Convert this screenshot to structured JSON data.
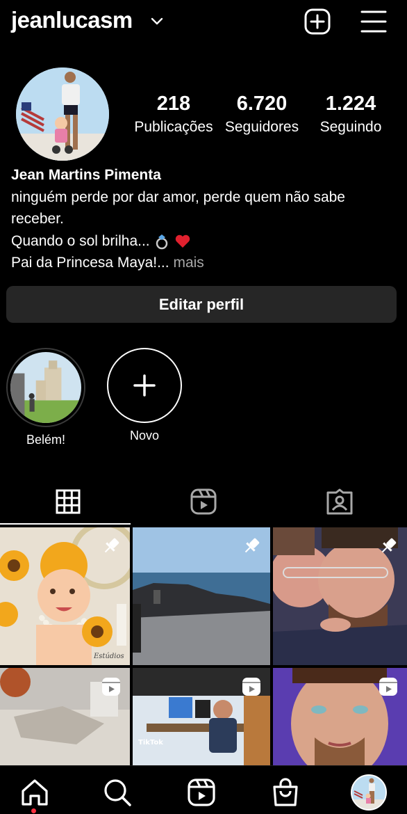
{
  "header": {
    "username": "jeanlucasm",
    "icons": {
      "dropdown": "chevron-down-icon",
      "create": "plus-square-icon",
      "menu": "hamburger-menu-icon"
    }
  },
  "profile": {
    "avatar": "profile-photo",
    "stats": [
      {
        "value": "218",
        "label": "Publicações"
      },
      {
        "value": "6.720",
        "label": "Seguidores"
      },
      {
        "value": "1.224",
        "label": "Seguindo"
      }
    ],
    "name": "Jean Martins Pimenta",
    "bio_lines": [
      "ninguém perde por dar amor, perde quem não sabe",
      "receber.",
      "Quando o sol brilha...",
      "Pai da Princesa Maya!..."
    ],
    "more_label": "mais",
    "emojis": [
      "ring-emoji",
      "red-heart-emoji"
    ]
  },
  "actions": {
    "edit_profile": "Editar perfil"
  },
  "highlights": [
    {
      "label": "Belém!"
    },
    {
      "label": "Novo"
    }
  ],
  "tabs": [
    "grid-icon",
    "reels-icon",
    "tagged-icon"
  ],
  "grid_posts": [
    {
      "badge": "pin-icon",
      "overlay": "Estúdios"
    },
    {
      "badge": "pin-icon"
    },
    {
      "badge": "pin-icon"
    },
    {
      "badge": "reels-icon"
    },
    {
      "badge": "reels-icon",
      "overlay": "TikTok"
    },
    {
      "badge": "reels-icon"
    }
  ],
  "bottom_nav": [
    "home-icon",
    "search-icon",
    "reels-icon",
    "shop-icon",
    "profile-avatar"
  ],
  "colors": {
    "background": "#000000",
    "button": "#262626",
    "muted_text": "#a8a8a8",
    "notification_dot": "#ff3040"
  }
}
